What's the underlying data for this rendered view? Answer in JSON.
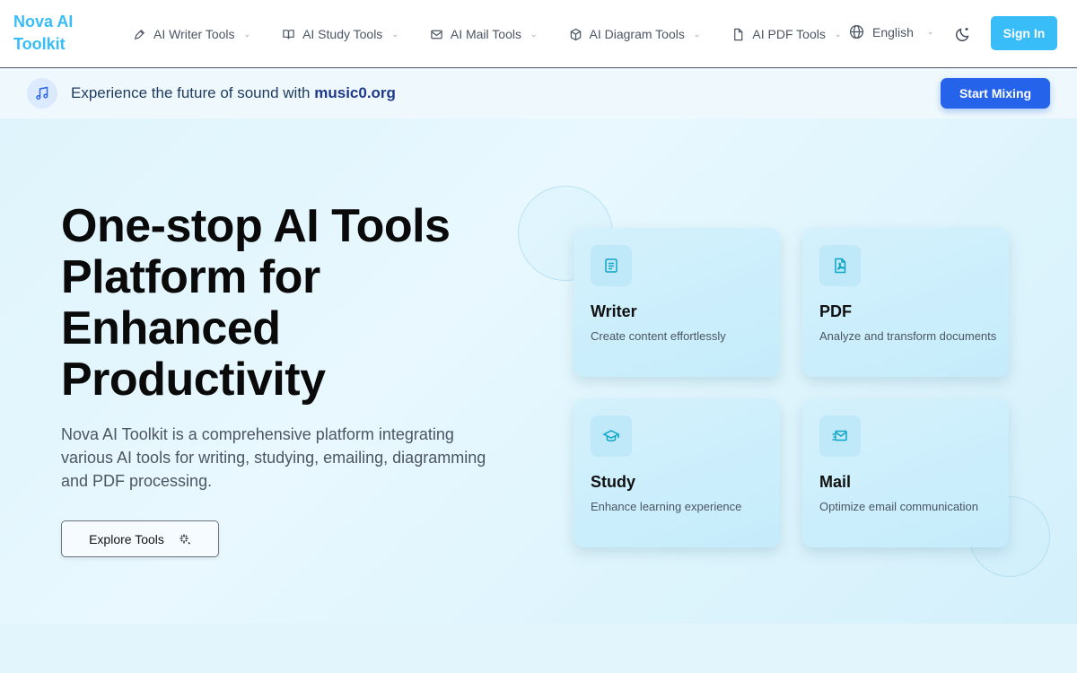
{
  "header": {
    "logo": "Nova AI Toolkit",
    "nav": [
      {
        "label": "AI Writer Tools",
        "icon": "pen-icon"
      },
      {
        "label": "AI Study Tools",
        "icon": "book-icon"
      },
      {
        "label": "AI Mail Tools",
        "icon": "mail-icon"
      },
      {
        "label": "AI Diagram Tools",
        "icon": "cube-icon"
      },
      {
        "label": "AI PDF Tools",
        "icon": "file-icon"
      }
    ],
    "language": "English",
    "sign_in": "Sign In"
  },
  "banner": {
    "text_prefix": "Experience the future of sound with",
    "brand": "music0.org",
    "cta": "Start Mixing"
  },
  "hero": {
    "title": "One-stop AI Tools Platform for Enhanced Productivity",
    "description": "Nova AI Toolkit is a comprehensive platform integrating various AI tools for writing, studying, emailing, diagramming and PDF processing.",
    "cta": "Explore Tools"
  },
  "cards": [
    {
      "title": "Writer",
      "desc": "Create content effortlessly",
      "icon": "document-icon"
    },
    {
      "title": "PDF",
      "desc": "Analyze and transform documents",
      "icon": "pdf-icon"
    },
    {
      "title": "Study",
      "desc": "Enhance learning experience",
      "icon": "graduation-cap-icon"
    },
    {
      "title": "Mail",
      "desc": "Optimize email communication",
      "icon": "send-mail-icon"
    }
  ],
  "colors": {
    "brand": "#38bdf8",
    "primary_button": "#2563eb",
    "card_bg": "#c5ecfb"
  }
}
